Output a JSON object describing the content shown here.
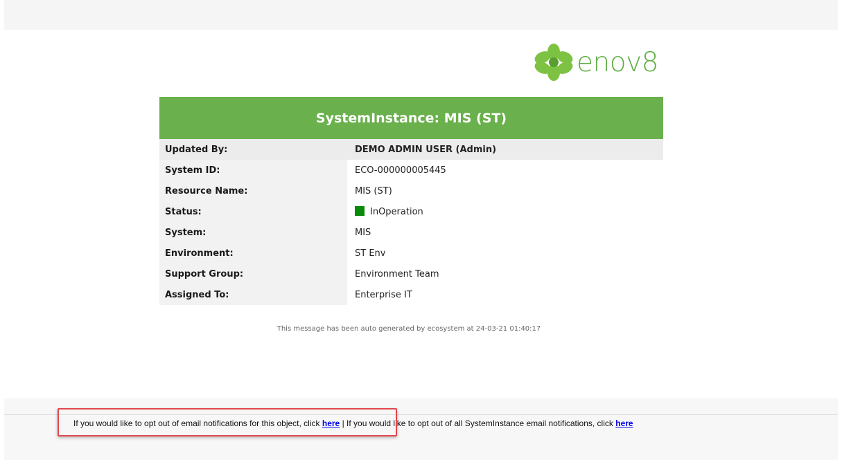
{
  "logo": {
    "text": "enov8",
    "brand_color": "#6ab04c"
  },
  "card": {
    "title": "SystemInstance: MIS (ST)",
    "rows": [
      {
        "label": "Updated By:",
        "value": "DEMO ADMIN USER (Admin)"
      },
      {
        "label": "System ID:",
        "value": "ECO-000000005445"
      },
      {
        "label": "Resource Name:",
        "value": "MIS (ST)"
      },
      {
        "label": "Status:",
        "value": "InOperation",
        "status_color": "#0a8a0a"
      },
      {
        "label": "System:",
        "value": "MIS"
      },
      {
        "label": "Environment:",
        "value": "ST Env"
      },
      {
        "label": "Support Group:",
        "value": "Environment Team"
      },
      {
        "label": "Assigned To:",
        "value": "Enterprise IT"
      }
    ]
  },
  "auto_message": "This message has been auto generated by ecosystem at 24-03-21 01:40:17",
  "optout": {
    "object_text": "If you would like to opt out of email notifications for this object, click",
    "object_link": "here",
    "separator": "|",
    "all_text": "If you would like to opt out of all SystemInstance email notifications, click",
    "all_link": "here"
  },
  "highlight_color": "#e0474c"
}
